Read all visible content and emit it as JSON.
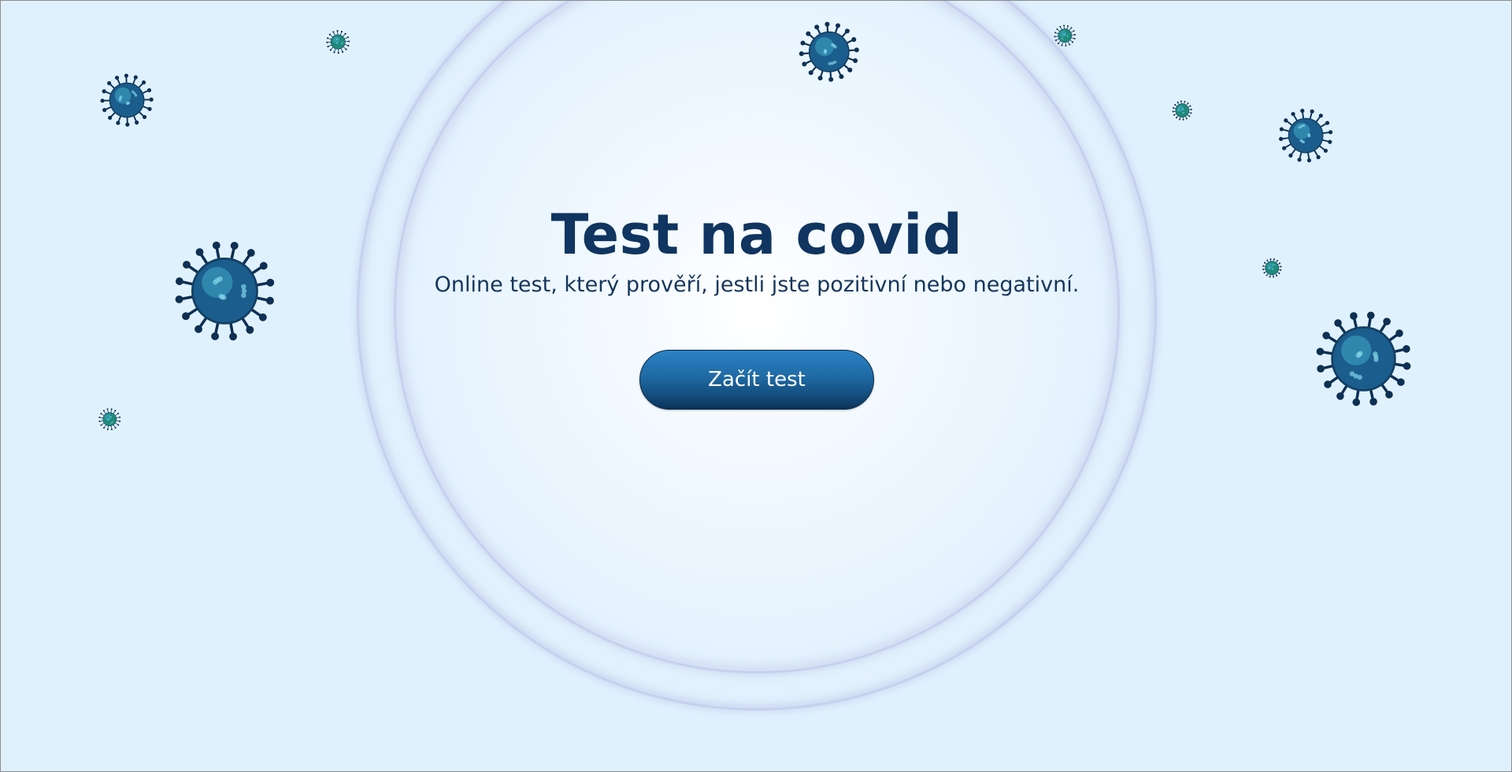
{
  "hero": {
    "title": "Test na covid",
    "subtitle": "Online test, který prověří, jestli jste pozitivní nebo negativní.",
    "start_button_label": "Začít test"
  },
  "decorations": {
    "icon": "virus-icon",
    "large_virus_color": "#1b5d8c",
    "small_virus_color": "#1f8a7a"
  },
  "colors": {
    "background": "#e0f1fe",
    "title": "#0f3560",
    "button": "#1b6aa6"
  }
}
